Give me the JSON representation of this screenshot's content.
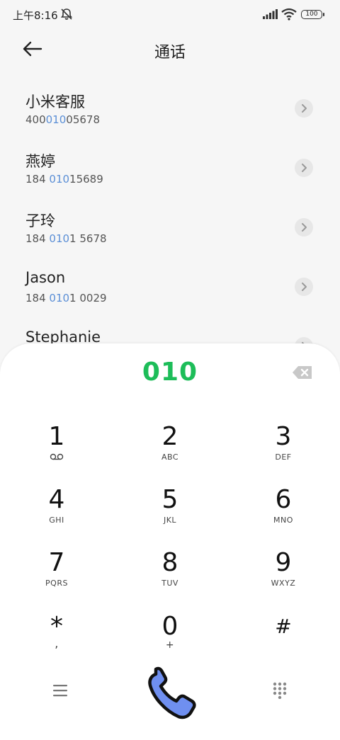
{
  "status_bar": {
    "time": "上午8:16",
    "battery": "100",
    "icons": [
      "bell-mute-icon",
      "signal-icon",
      "wifi-icon",
      "battery-icon"
    ]
  },
  "header": {
    "title": "通话",
    "back_icon": "back-arrow-icon"
  },
  "contacts": [
    {
      "name": "小米客服",
      "number_pre": "400",
      "number_hl": "010",
      "number_post": "05678"
    },
    {
      "name": "燕婷",
      "number_pre": "184 ",
      "number_hl": "010",
      "number_post": "15689"
    },
    {
      "name": "子玲",
      "number_pre": "184 ",
      "number_hl": "010",
      "number_post": "1 5678"
    },
    {
      "name": "Jason",
      "number_pre": "184 ",
      "number_hl": "010",
      "number_post": "1 0029"
    },
    {
      "name": "Stephanie",
      "number_pre": "",
      "number_hl": "",
      "number_post": ""
    }
  ],
  "dialpad": {
    "number": "010",
    "keys": [
      {
        "digit": "1",
        "letters": ""
      },
      {
        "digit": "2",
        "letters": "ABC"
      },
      {
        "digit": "3",
        "letters": "DEF"
      },
      {
        "digit": "4",
        "letters": "GHI"
      },
      {
        "digit": "5",
        "letters": "JKL"
      },
      {
        "digit": "6",
        "letters": "MNO"
      },
      {
        "digit": "7",
        "letters": "PQRS"
      },
      {
        "digit": "8",
        "letters": "TUV"
      },
      {
        "digit": "9",
        "letters": "WXYZ"
      },
      {
        "digit": "*",
        "letters": ","
      },
      {
        "digit": "0",
        "letters": "+"
      },
      {
        "digit": "#",
        "letters": ""
      }
    ]
  },
  "colors": {
    "accent_green": "#1dbd59",
    "highlight_blue": "#5b8fd6",
    "call_button": "#6f8ff0"
  }
}
